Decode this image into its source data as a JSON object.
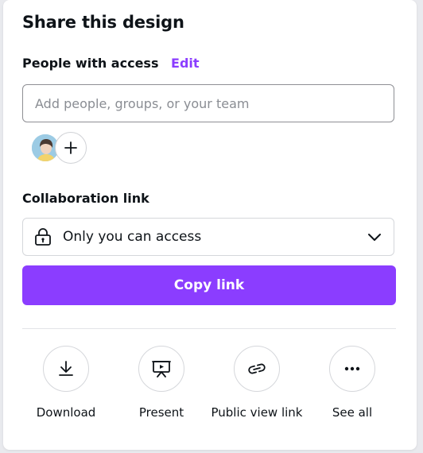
{
  "dialog": {
    "title": "Share this design"
  },
  "people": {
    "label": "People with access",
    "edit_label": "Edit",
    "input_placeholder": "Add people, groups, or your team",
    "input_value": ""
  },
  "collaboration": {
    "label": "Collaboration link",
    "selected_access": "Only you can access",
    "copy_button": "Copy link"
  },
  "actions": [
    {
      "label": "Download",
      "icon": "download-icon"
    },
    {
      "label": "Present",
      "icon": "present-icon"
    },
    {
      "label": "Public view link",
      "icon": "link-icon"
    },
    {
      "label": "See all",
      "icon": "more-icon"
    }
  ],
  "colors": {
    "accent": "#8b3dff",
    "text": "#0e1318",
    "border": "#d5d7db"
  }
}
